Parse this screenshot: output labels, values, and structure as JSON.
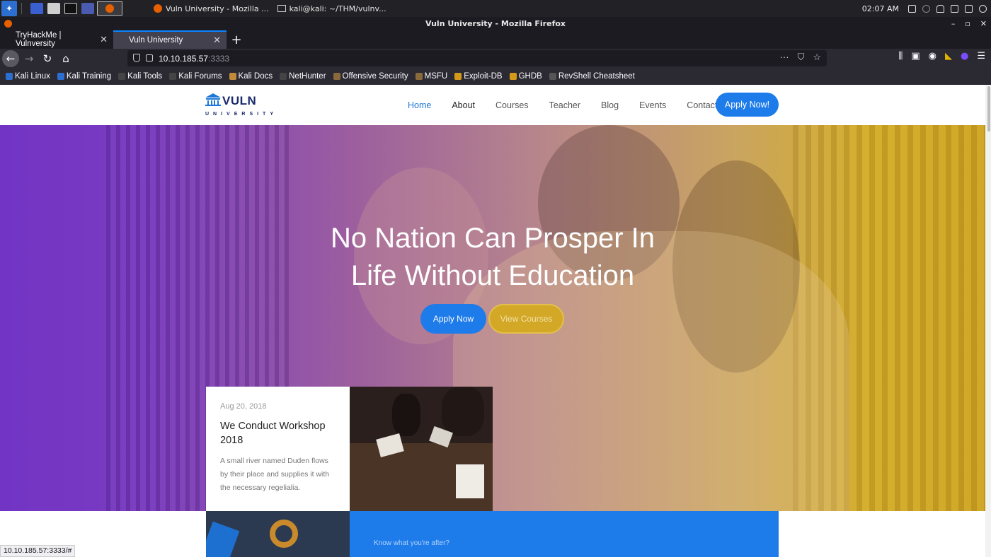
{
  "system_panel": {
    "clock": "02:07 AM",
    "tasks": [
      {
        "label": "Vuln University - Mozilla ...",
        "icon": "firefox-icon"
      },
      {
        "label": "kali@kali: ~/THM/vulnv...",
        "icon": "terminal-icon"
      }
    ]
  },
  "window": {
    "title": "Vuln University - Mozilla Firefox"
  },
  "tabs": [
    {
      "label": "TryHackMe | Vulnversity",
      "selected": false
    },
    {
      "label": "Vuln University",
      "selected": true
    }
  ],
  "urlbar": {
    "host": "10.10.185.57",
    "port": ":3333"
  },
  "bookmarks": [
    {
      "label": "Kali Linux",
      "color": "#2d6fd0"
    },
    {
      "label": "Kali Training",
      "color": "#2d6fd0"
    },
    {
      "label": "Kali Tools",
      "color": "#444"
    },
    {
      "label": "Kali Forums",
      "color": "#444"
    },
    {
      "label": "Kali Docs",
      "color": "#c28a3a"
    },
    {
      "label": "NetHunter",
      "color": "#444"
    },
    {
      "label": "Offensive Security",
      "color": "#8a6a3a"
    },
    {
      "label": "MSFU",
      "color": "#8a6a3a"
    },
    {
      "label": "Exploit-DB",
      "color": "#d69a1a"
    },
    {
      "label": "GHDB",
      "color": "#d69a1a"
    },
    {
      "label": "RevShell Cheatsheet",
      "color": "#555"
    }
  ],
  "site": {
    "logo": {
      "main": "VULN",
      "sub": "UNIVERSITY"
    },
    "menu": [
      {
        "label": "Home"
      },
      {
        "label": "About"
      },
      {
        "label": "Courses"
      },
      {
        "label": "Teacher"
      },
      {
        "label": "Blog"
      },
      {
        "label": "Events"
      },
      {
        "label": "Contact"
      }
    ],
    "apply_nav": "Apply Now!",
    "hero": {
      "heading_line1": "No Nation Can Prosper In",
      "heading_line2": "Life Without Education",
      "apply_button": "Apply Now",
      "courses_button": "View Courses"
    },
    "event_card": {
      "date": "Aug 20, 2018",
      "title": "We Conduct Workshop 2018",
      "description": "A small river named Duden flows by their place and supplies it with the necessary regelialia."
    },
    "info_box": {
      "kicker": "Know what you're after?"
    }
  },
  "statusbar": {
    "url": "10.10.185.57:3333/#"
  }
}
